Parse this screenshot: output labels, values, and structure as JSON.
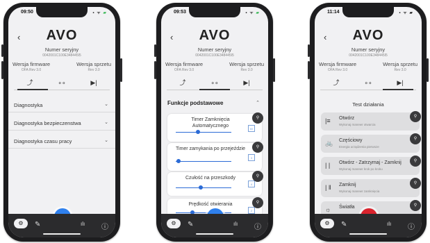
{
  "common": {
    "app_title": "AVO",
    "back_icon": "‹",
    "serial_label": "Numer seryjny",
    "serial_value": "0042001C100E348445I5",
    "firmware_label": "Wersja firmware",
    "firmware_value": "OFA Rev 3.0",
    "hardware_label": "Wersja sprzetu",
    "hardware_value": "Rev 3.0",
    "tabs": [
      "⤴",
      "∘∘",
      "▶|"
    ],
    "status_icons": "▪ ᯤ",
    "battery": "▰",
    "bluetooth_icon": "✱",
    "nav_icons": [
      "⚙",
      "✎",
      "ılı",
      "ⓘ"
    ]
  },
  "screen1": {
    "time": "09:50",
    "accordions": [
      "Diagnostyka",
      "Diagnostyka bezpieczenstwa",
      "Diagnostyka czasu pracy"
    ]
  },
  "screen2": {
    "time": "09:53",
    "section_title": "Funkcje podstawowe",
    "settings": [
      {
        "label": "Timer Zamknięcia Automatycznego",
        "value": "60",
        "level": 0.4
      },
      {
        "label": "Timer zamykania po przejeździe",
        "value": "3",
        "level": 0.05
      },
      {
        "label": "Czułość na przeszkody",
        "value": "4",
        "level": 0.45
      },
      {
        "label": "Prędkość otwierania",
        "value": "2",
        "level": 0.3
      }
    ]
  },
  "screen3": {
    "time": "11:14",
    "section_title": "Test działania",
    "tests": [
      {
        "icon": "|≡",
        "label": "Otwórz",
        "sub": "Wykonaj manewr otwarcia"
      },
      {
        "icon": "🚲",
        "label": "Częściowy",
        "sub": "Energia urządzenia pierwsze"
      },
      {
        "icon": "| |",
        "label": "Otwórz - Zatrzymaj - Zamknij",
        "sub": "Wykonaj manewr krok po kroku"
      },
      {
        "icon": "| ‖",
        "label": "Zamknij",
        "sub": "Wykonaj manewr zamknięcia"
      },
      {
        "icon": "☼",
        "label": "Światła",
        "sub": ""
      }
    ]
  }
}
